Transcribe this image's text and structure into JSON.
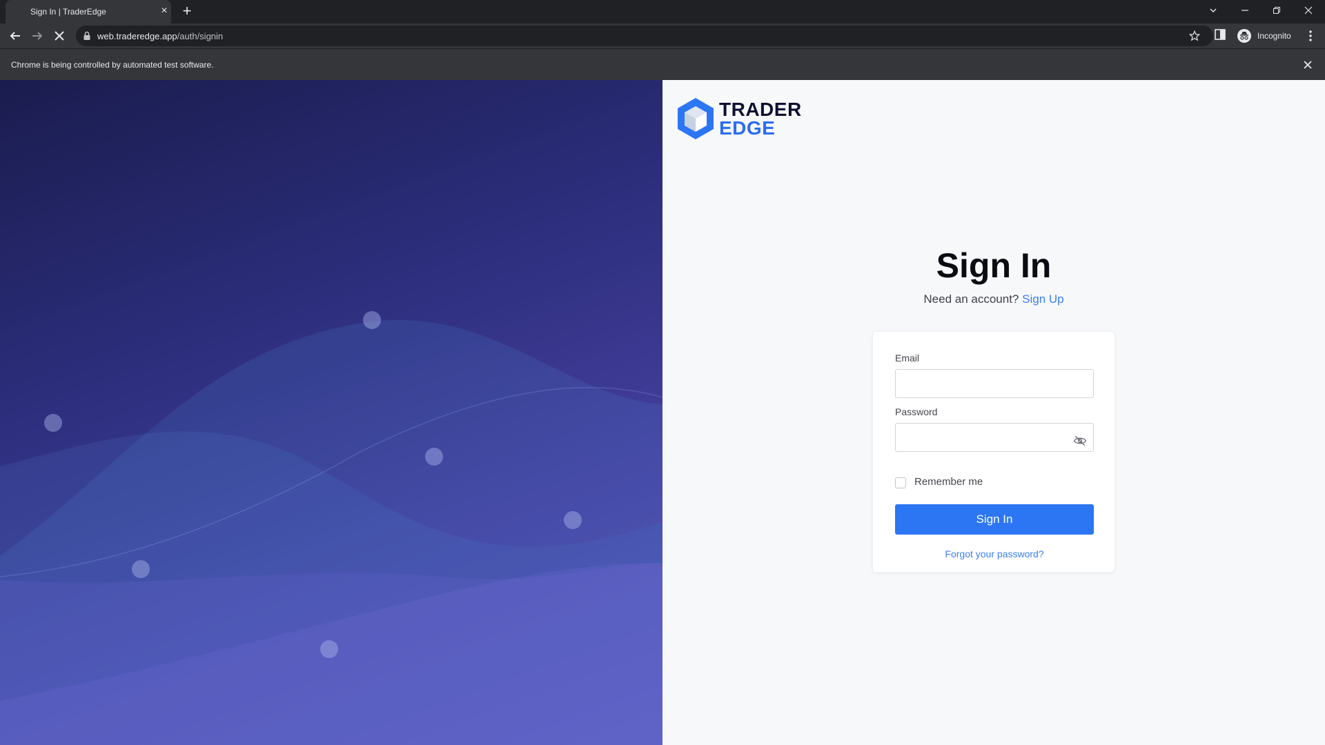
{
  "browser": {
    "tab_title": "Sign In | TraderEdge",
    "url_host": "web.traderedge.app",
    "url_path": "/auth/signin",
    "profile_label": "Incognito",
    "infobar_text": "Chrome is being controlled by automated test software."
  },
  "brand": {
    "name_line1": "TRADER",
    "name_line2": "EDGE",
    "accent_color": "#2c76f4"
  },
  "signin": {
    "title": "Sign In",
    "prompt": "Need an account?",
    "signup_link": "Sign Up",
    "email_label": "Email",
    "email_value": "",
    "password_label": "Password",
    "password_value": "",
    "remember_label": "Remember me",
    "remember_checked": false,
    "submit_label": "Sign In",
    "forgot_link": "Forgot your password?"
  },
  "icons": {
    "tab_close": "close-icon",
    "new_tab": "plus-icon",
    "back": "arrow-left-icon",
    "forward": "arrow-right-icon",
    "stop": "close-icon",
    "lock": "lock-icon",
    "bookmark": "star-icon",
    "side_panel": "side-panel-icon",
    "incognito": "incognito-icon",
    "menu": "kebab-menu-icon",
    "password_toggle": "eye-off-icon"
  }
}
